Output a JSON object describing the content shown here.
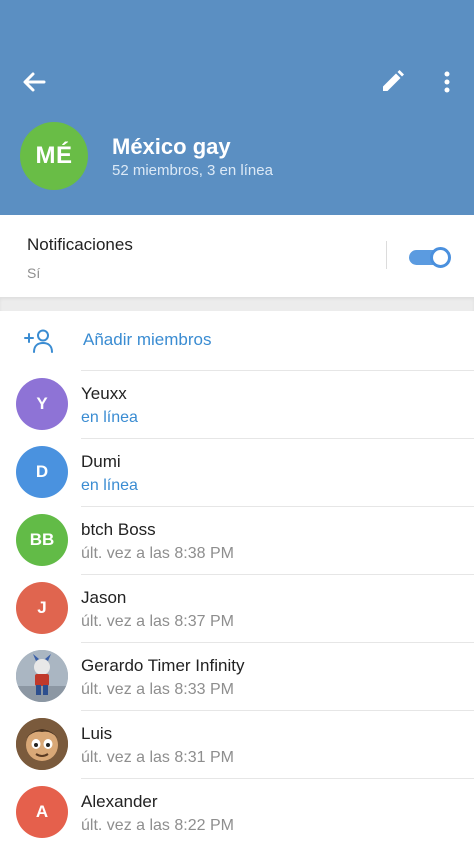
{
  "header": {
    "avatar_initials": "MÉ",
    "avatar_color": "#69bd46",
    "title": "México gay",
    "subtitle": "52 miembros, 3 en línea",
    "background": "#5b8fc2",
    "icons": [
      "back-arrow-icon",
      "pencil-icon",
      "more-vertical-icon"
    ]
  },
  "notifications": {
    "title": "Notificaciones",
    "value": "Sí",
    "enabled": true
  },
  "add_members": {
    "label": "Añadir miembros",
    "icon": "add-user-icon"
  },
  "members": [
    {
      "name": "Yeuxx",
      "status": "en línea",
      "online": true,
      "initials": "Y",
      "color": "#8e73d6"
    },
    {
      "name": "Dumi",
      "status": "en línea",
      "online": true,
      "initials": "D",
      "color": "#4a92df"
    },
    {
      "name": "btch Boss",
      "status": "últ. vez a las 8:38 PM",
      "online": false,
      "initials": "BB",
      "color": "#62bb47"
    },
    {
      "name": "Jason",
      "status": "últ. vez a las 8:37 PM",
      "online": false,
      "initials": "J",
      "color": "#e0654f"
    },
    {
      "name": "Gerardo Timer Infinity",
      "status": "últ. vez a las 8:33 PM",
      "online": false,
      "initials": "",
      "color": "#9aa7b3",
      "photo": true
    },
    {
      "name": "Luis",
      "status": "últ. vez a las 8:31 PM",
      "online": false,
      "initials": "",
      "color": "#8a6a4a",
      "photo": true
    },
    {
      "name": "Alexander",
      "status": "últ. vez a las 8:22 PM",
      "online": false,
      "initials": "A",
      "color": "#e5604c"
    }
  ]
}
